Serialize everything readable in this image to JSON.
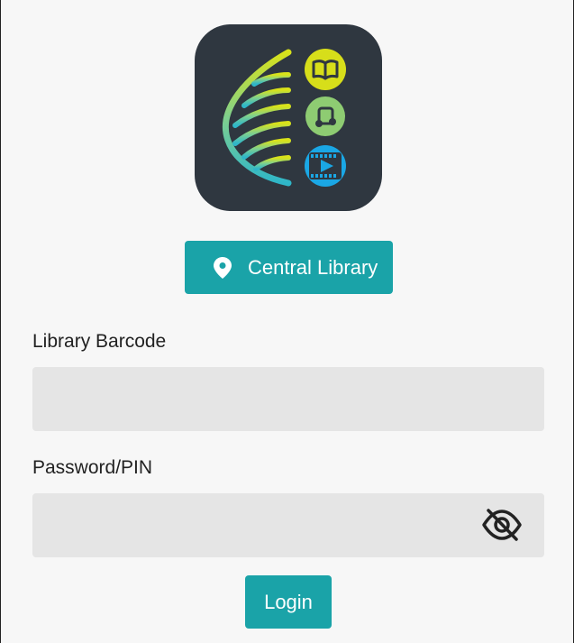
{
  "app": {
    "logo": {
      "icon": "library-app-logo",
      "badges": [
        "book-icon",
        "music-note-icon",
        "video-play-icon"
      ]
    }
  },
  "location": {
    "label": "Central Library",
    "icon": "location-pin-icon"
  },
  "form": {
    "barcode_label": "Library Barcode",
    "barcode_value": "",
    "pin_label": "Password/PIN",
    "pin_value": "",
    "visibility_icon": "eye-off-icon"
  },
  "actions": {
    "login_label": "Login"
  },
  "colors": {
    "accent": "#1aa3a8",
    "logo_bg": "#2f3740",
    "input_bg": "#e5e5e5",
    "badge_book": "#d7de1a",
    "badge_music": "#8ecc72",
    "badge_video": "#1aa7e5"
  }
}
